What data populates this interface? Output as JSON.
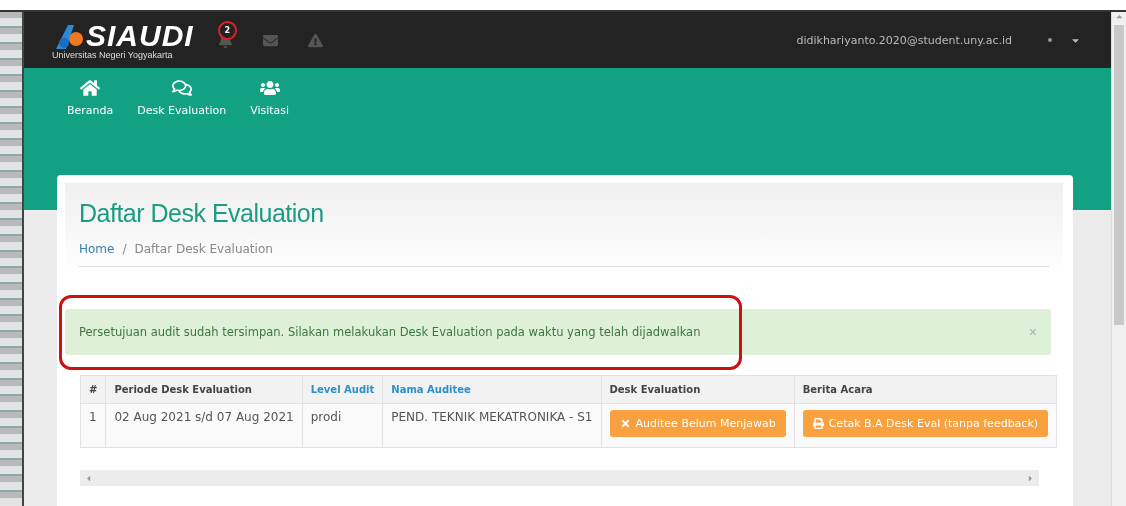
{
  "header": {
    "logo": {
      "title": "SIAUDI",
      "subtitle": "Universitas Negeri Yogyakarta"
    },
    "notifications": [
      {
        "kind": "bell",
        "badge": "2"
      },
      {
        "kind": "envelope"
      },
      {
        "kind": "warning"
      }
    ],
    "user": {
      "email": "didikhariyanto.2020@student.uny.ac.id"
    }
  },
  "nav": [
    {
      "kind": "home",
      "label": "Beranda"
    },
    {
      "kind": "comments",
      "label": "Desk Evaluation"
    },
    {
      "kind": "users",
      "label": "Visitasi"
    }
  ],
  "page": {
    "title": "Daftar Desk Evaluation",
    "breadcrumb_separator": "/",
    "breadcrumb": [
      {
        "label": "Home",
        "link": true
      },
      {
        "label": "Daftar Desk Evaluation",
        "link": false
      }
    ]
  },
  "alert": {
    "message": "Persetujuan audit sudah tersimpan. Silakan melakukan Desk Evaluation pada waktu yang telah dijadwalkan",
    "close": "×",
    "highlighted": true
  },
  "table": {
    "columns": [
      {
        "label": "#",
        "sortable": false
      },
      {
        "label": "Periode Desk Evaluation",
        "sortable": false
      },
      {
        "label": "Level Audit",
        "sortable": true
      },
      {
        "label": "Nama Auditee",
        "sortable": true
      },
      {
        "label": "Desk Evaluation",
        "sortable": false
      },
      {
        "label": "Berita Acara",
        "sortable": false
      }
    ],
    "rows": [
      {
        "cells": [
          {
            "kind": "text",
            "text": "1"
          },
          {
            "kind": "text",
            "text": "02 Aug 2021 s/d 07 Aug 2021"
          },
          {
            "kind": "text",
            "text": "prodi"
          },
          {
            "kind": "text",
            "text": "PEND. TEKNIK MEKATRONIKA - S1"
          },
          {
            "kind": "cancel-button",
            "text": "Auditee Belum Menjawab"
          },
          {
            "kind": "print-button",
            "text": "Cetak B.A Desk Eval (tanpa feedback)"
          }
        ]
      }
    ]
  }
}
